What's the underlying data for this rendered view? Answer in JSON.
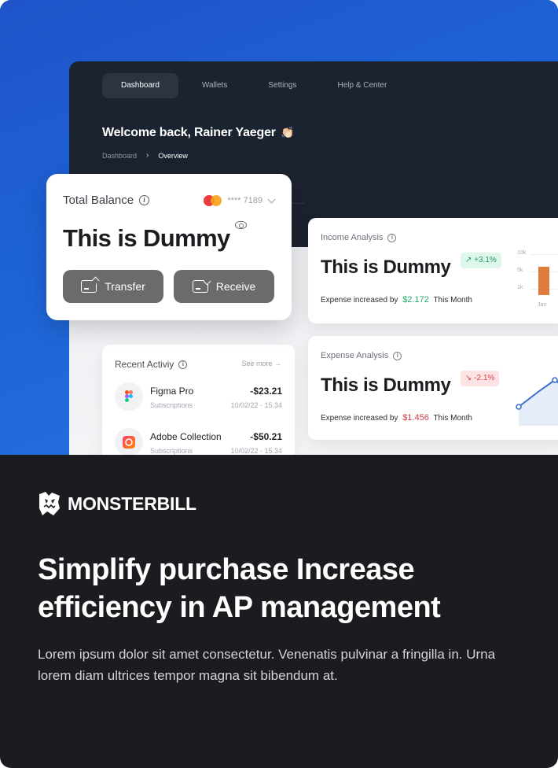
{
  "nav": {
    "items": [
      "Dashboard",
      "Wallets",
      "Settings",
      "Help & Center"
    ],
    "active": "Dashboard"
  },
  "welcome": {
    "text": "Welcome back, Rainer Yaeger",
    "emoji": "👏🏻"
  },
  "breadcrumb": {
    "parent": "Dashboard",
    "current": "Overview"
  },
  "balance": {
    "label": "Total Balance",
    "card_mask": "**** 7189",
    "amount": "This is Dummy",
    "transfer_label": "Transfer",
    "receive_label": "Receive"
  },
  "income": {
    "title": "Income Analysis",
    "amount": "This is Dummy",
    "badge": "↗ +3.1%",
    "note_prefix": "Expense increased by",
    "note_value": "$2.172",
    "note_suffix": "This Month",
    "axis_ticks": [
      "10k",
      "5k",
      "1k"
    ],
    "x_label": "Jan"
  },
  "expense": {
    "title": "Expense Analysis",
    "amount": "This is Dummy",
    "badge": "↘ -2.1%",
    "note_prefix": "Expense increased by",
    "note_value": "$1.456",
    "note_suffix": "This Month"
  },
  "activity": {
    "title": "Recent Activiy",
    "see_more": "See more",
    "rows": [
      {
        "name": "Figma Pro",
        "category": "Subscriptions",
        "amount": "-$23.21",
        "date": "10/02/22 - 15.34",
        "icon": "figma-icon"
      },
      {
        "name": "Adobe Collection",
        "category": "Subscriptions",
        "amount": "-$50.21",
        "date": "10/02/22 - 15.34",
        "icon": "adobe-icon"
      }
    ]
  },
  "brand": {
    "name": "MONSTERBILL"
  },
  "headline": "Simplify purchase Increase efficiency in AP management",
  "body": "Lorem ipsum dolor sit amet consectetur. Venenatis pulvinar a fringilla in. Urna lorem diam ultrices tempor magna sit bibendum at.",
  "colors": {
    "hero_blue": "#1d64d6",
    "dark_panel": "#1c2330",
    "footer_bg": "#1b1c1f",
    "positive": "#1bae69",
    "negative": "#d23b47",
    "bar_orange": "#e07b3c",
    "line_blue": "#3b6fd0"
  }
}
